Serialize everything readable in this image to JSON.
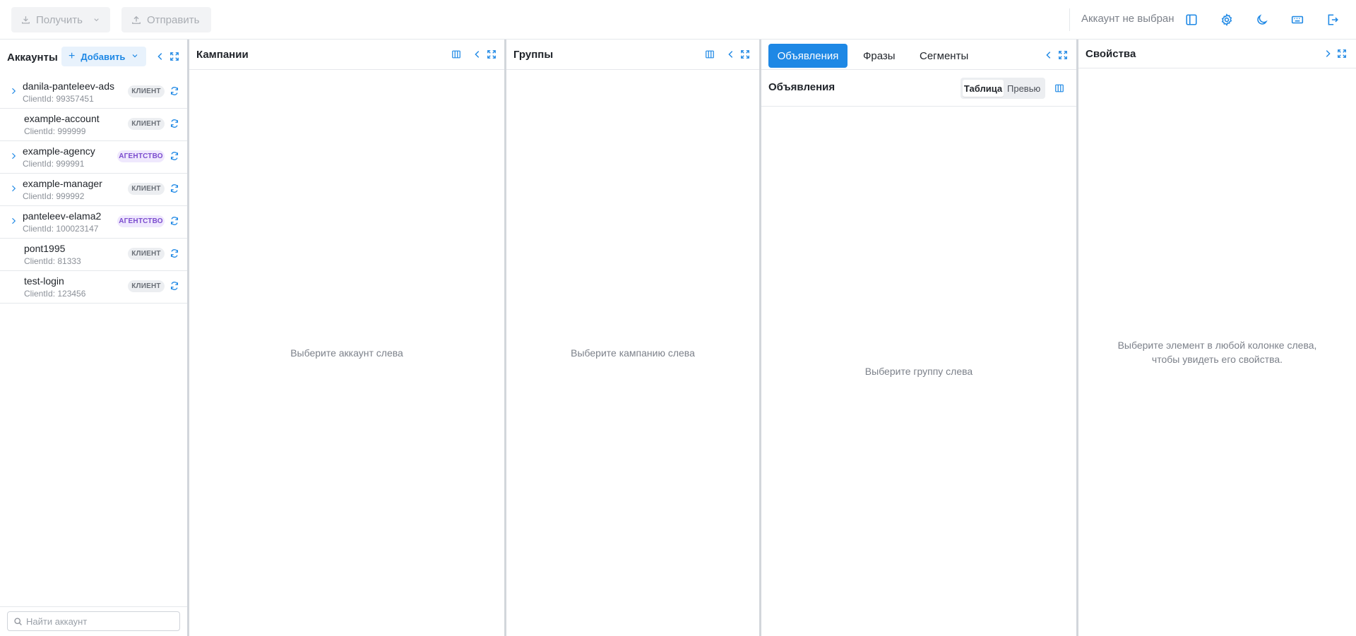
{
  "toolbar": {
    "get_label": "Получить",
    "send_label": "Отправить",
    "account_status": "Аккаунт не выбран",
    "icons": [
      "sidebar-toggle-icon",
      "gear-icon",
      "moon-icon",
      "keyboard-icon",
      "logout-icon"
    ]
  },
  "accounts": {
    "title": "Аккаунты",
    "add_label": "Добавить",
    "search_placeholder": "Найти аккаунт",
    "items": [
      {
        "name": "danila-panteleev-ads",
        "client_id": "ClientId: 99357451",
        "badge": "КЛИЕНТ",
        "type": "client",
        "expandable": true
      },
      {
        "name": "example-account",
        "client_id": "ClientId: 999999",
        "badge": "КЛИЕНТ",
        "type": "client",
        "expandable": false
      },
      {
        "name": "example-agency",
        "client_id": "ClientId: 999991",
        "badge": "АГЕНТСТВО",
        "type": "agency",
        "expandable": true
      },
      {
        "name": "example-manager",
        "client_id": "ClientId: 999992",
        "badge": "КЛИЕНТ",
        "type": "client",
        "expandable": true
      },
      {
        "name": "panteleev-elama2",
        "client_id": "ClientId: 100023147",
        "badge": "АГЕНТСТВО",
        "type": "agency",
        "expandable": true
      },
      {
        "name": "pont1995",
        "client_id": "ClientId: 81333",
        "badge": "КЛИЕНТ",
        "type": "client",
        "expandable": false
      },
      {
        "name": "test-login",
        "client_id": "ClientId: 123456",
        "badge": "КЛИЕНТ",
        "type": "client",
        "expandable": false
      }
    ]
  },
  "campaigns": {
    "title": "Кампании",
    "empty": "Выберите аккаунт слева"
  },
  "groups": {
    "title": "Группы",
    "empty": "Выберите кампанию слева"
  },
  "ads": {
    "tabs": [
      "Объявления",
      "Фразы",
      "Сегменты"
    ],
    "subtitle": "Объявления",
    "view_table": "Таблица",
    "view_preview": "Превью",
    "empty": "Выберите группу слева"
  },
  "properties": {
    "title": "Свойства",
    "empty_line1": "Выберите элемент в любой колонке слева,",
    "empty_line2": "чтобы увидеть его свойства."
  },
  "colors": {
    "accent": "#1e88e5",
    "agency_badge": "#7c4dcf",
    "client_badge": "#6b7078"
  }
}
